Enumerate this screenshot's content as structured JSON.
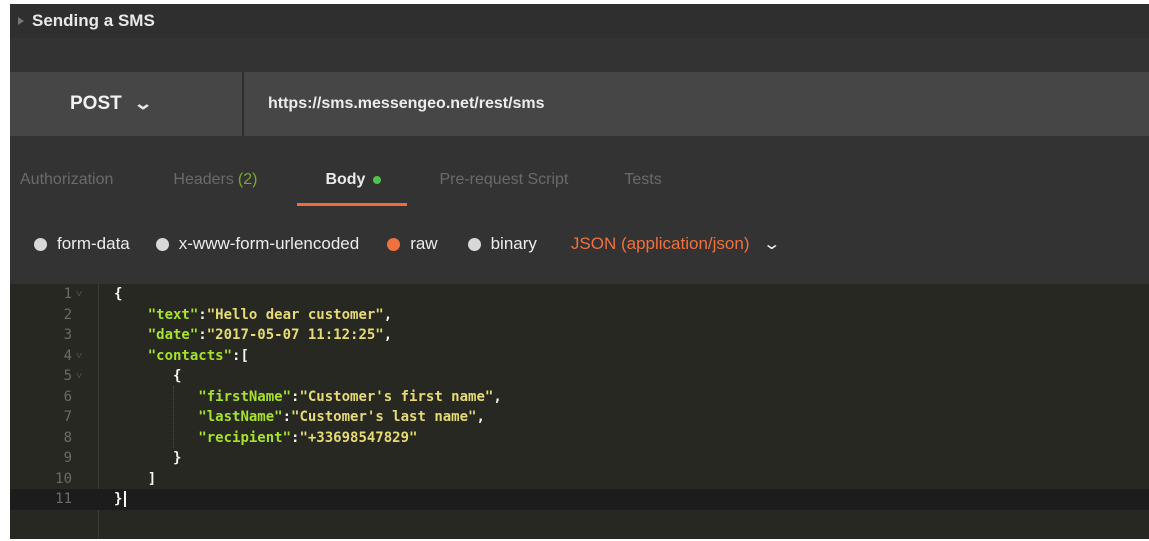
{
  "title": "Sending a SMS",
  "request": {
    "method": "POST",
    "url": "https://sms.messengeo.net/rest/sms"
  },
  "tabs": [
    {
      "label": "Authorization"
    },
    {
      "label": "Headers",
      "count": "(2)"
    },
    {
      "label": "Body",
      "active": true
    },
    {
      "label": "Pre-request Script"
    },
    {
      "label": "Tests"
    }
  ],
  "body_options": [
    {
      "label": "form-data",
      "selected": false
    },
    {
      "label": "x-www-form-urlencoded",
      "selected": false
    },
    {
      "label": "raw",
      "selected": true
    },
    {
      "label": "binary",
      "selected": false
    }
  ],
  "format": "JSON (application/json)",
  "colors": {
    "accent": "#f0713d",
    "active_dot": "#4fc44f",
    "json_key": "#a6e22e",
    "json_string": "#e6db74"
  },
  "editor": {
    "line_numbers": [
      "1",
      "2",
      "3",
      "4",
      "5",
      "6",
      "7",
      "8",
      "9",
      "10",
      "11"
    ],
    "lines": [
      {
        "indent": "",
        "punct_before": "{"
      },
      {
        "indent": "    ",
        "key": "\"text\"",
        "punct": ":",
        "value": "\"Hello dear customer\"",
        "punct_after": ","
      },
      {
        "indent": "    ",
        "key": "\"date\"",
        "punct": ":",
        "value": "\"2017-05-07 11:12:25\"",
        "punct_after": ","
      },
      {
        "indent": "    ",
        "key": "\"contacts\"",
        "punct": ":["
      },
      {
        "indent": "       ",
        "punct_before": "{"
      },
      {
        "indent": "          ",
        "key": "\"firstName\"",
        "punct": ":",
        "value": "\"Customer's first name\"",
        "punct_after": ","
      },
      {
        "indent": "          ",
        "key": "\"lastName\"",
        "punct": ":",
        "value": "\"Customer's last name\"",
        "punct_after": ","
      },
      {
        "indent": "          ",
        "key": "\"recipient\"",
        "punct": ":",
        "value": "\"+33698547829\""
      },
      {
        "indent": "       ",
        "punct_before": "}"
      },
      {
        "indent": "    ",
        "punct_before": "]"
      },
      {
        "indent": "",
        "punct_before": "}"
      }
    ]
  }
}
